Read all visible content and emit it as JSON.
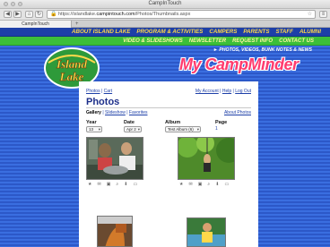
{
  "browser": {
    "window_title": "CampInTouch",
    "url_prefix": "https://islandlake.",
    "url_domain": "campintouch.com",
    "url_path": "/Photos/Thumbnails.aspx",
    "tab_label": "CampInTouch",
    "new_tab": "+"
  },
  "site": {
    "logo_text": "Island Lake",
    "brand": "My CampMinder",
    "tagline": "► PHOTOS, VIDEOS, BUNK NOTES & NEWS",
    "nav_primary": [
      "ABOUT ISLAND LAKE",
      "PROGRAM & ACTIVITIES",
      "CAMPERS",
      "PARENTS",
      "STAFF",
      "ALUMNI"
    ],
    "nav_secondary": [
      "VIDEO & SLIDESHOWS",
      "NEWSLETTER",
      "REQUEST INFO",
      "CONTACT US"
    ]
  },
  "content": {
    "breadcrumb_photos": "Photos",
    "breadcrumb_sep": " | ",
    "breadcrumb_cart": "Cart",
    "my_account": "My Account",
    "help": "Help",
    "logout": "Log Out",
    "page_title": "Photos",
    "subnav_gallery": "Gallery",
    "subnav_slideshow": "Slideshow",
    "subnav_favorites": "Favorites",
    "about_photos": "About Photos",
    "filters": {
      "year_label": "Year",
      "year_value": "13",
      "date_label": "Date",
      "date_value": "Apr 2",
      "album_label": "Album",
      "album_value": "Test Album (6)",
      "page_label": "Page",
      "page_value": "1"
    },
    "photo_actions": [
      "★",
      "✉",
      "▣",
      "⌕",
      "⬇",
      "▭"
    ]
  }
}
